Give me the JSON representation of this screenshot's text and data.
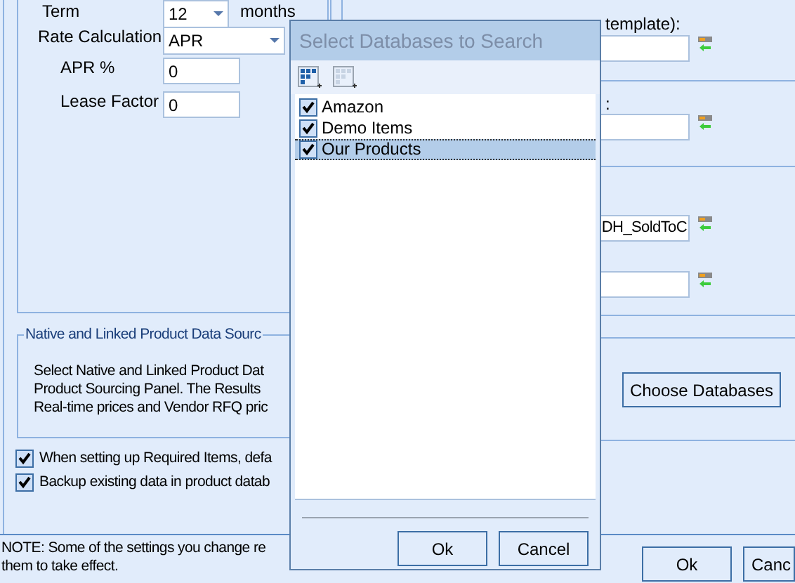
{
  "term": {
    "label": "Term",
    "value": "12",
    "unit": "months"
  },
  "rate_calculation": {
    "label": "Rate Calculation",
    "value": "APR"
  },
  "apr_percent": {
    "label": "APR %",
    "value": "0"
  },
  "lease_factor": {
    "label": "Lease Factor",
    "value": "0"
  },
  "right_fields": [
    {
      "kind": "field",
      "label": "template):"
    },
    {
      "kind": "field",
      "label": ":"
    },
    {
      "kind": "field",
      "value": "DH_SoldToC"
    },
    {
      "kind": "field"
    }
  ],
  "data_sources": {
    "title": "Native and Linked Product Data Sourc",
    "lines": [
      "Select Native and Linked Product Dat",
      "Product Sourcing Panel. The Results",
      "Real-time prices and Vendor RFQ pric"
    ],
    "button": "Choose Databases"
  },
  "options": [
    {
      "label": "When setting up Required Items, defa",
      "checked": true
    },
    {
      "label": "Backup existing data in product datab",
      "checked": true
    }
  ],
  "note": [
    "NOTE: Some of the settings you change re",
    "them to take effect."
  ],
  "buttons": [
    "Ok",
    "Canc"
  ],
  "dialog": {
    "title": "Select Databases to Search",
    "items": [
      {
        "label": "Amazon",
        "checked": true,
        "selected": false
      },
      {
        "label": "Demo Items",
        "checked": true,
        "selected": false
      },
      {
        "label": "Our Products",
        "checked": true,
        "selected": true
      }
    ],
    "buttons": [
      "Ok",
      "Cancel"
    ]
  }
}
